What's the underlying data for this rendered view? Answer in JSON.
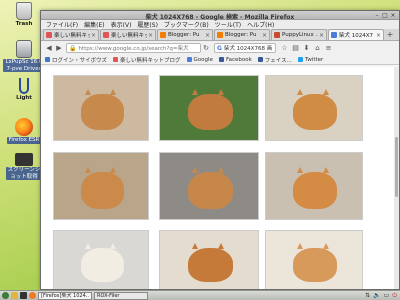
{
  "desktop": {
    "icons": [
      {
        "label": "Trash",
        "icon": "trash-icon"
      },
      {
        "label": "LxPupSc 16.0\n7-pve Drives",
        "icon": "drive-icon"
      },
      {
        "label": "Light",
        "icon": "light-icon"
      },
      {
        "label": "Firefox ESR",
        "icon": "firefox-icon"
      },
      {
        "label": "スクリーンシ\nョット取得",
        "icon": "camera-icon"
      }
    ]
  },
  "window": {
    "title": "柴犬 1024X768 - Google 検索 - Mozilla Firefox",
    "menu": [
      "ファイル(F)",
      "編集(E)",
      "表示(V)",
      "履歴(S)",
      "ブックマーク(B)",
      "ツール(T)",
      "ヘルプ(H)"
    ],
    "tabs": [
      {
        "label": "楽しい無料キット",
        "favicon": "bookmark-icon",
        "color": "#e05555"
      },
      {
        "label": "楽しい無料キットB",
        "favicon": "bookmark-icon",
        "color": "#e05555"
      },
      {
        "label": "Blogger: Pu",
        "favicon": "blogger-icon",
        "color": "#f57d00"
      },
      {
        "label": "Blogger: Pu",
        "favicon": "blogger-icon",
        "color": "#f57d00"
      },
      {
        "label": "PuppyLinux ...",
        "favicon": "puppy-icon",
        "color": "#c84a2f"
      },
      {
        "label": "柴犬 1024X7",
        "favicon": "google-icon",
        "color": "#4a7ed8"
      }
    ],
    "url": "https://www.google.co.jp/search?q=柴犬",
    "search_query": "柴犬 1024X768 画",
    "bookmarks": [
      {
        "label": "ログイン・サイボウズ",
        "color": "#3a78c8"
      },
      {
        "label": "楽しい無料キットブログ",
        "color": "#e05555"
      },
      {
        "label": "Google",
        "color": "#4a7ed8"
      },
      {
        "label": "Facebook",
        "color": "#3b5998"
      },
      {
        "label": "フェイス...",
        "color": "#3b5998"
      },
      {
        "label": "Twitter",
        "color": "#1da1f2"
      }
    ]
  },
  "results": {
    "images": [
      {
        "description": "shiba-lying-on-floor",
        "bg": "#cdb8a0",
        "dog": "#c8894c"
      },
      {
        "description": "shiba-on-grass",
        "bg": "#4f7a3a",
        "dog": "#c27b3f"
      },
      {
        "description": "shiba-puppy-closeup",
        "bg": "#d9d2c3",
        "dog": "#d08b45"
      },
      {
        "description": "shiba-puppy-on-wooden-board",
        "bg": "#b9a58a",
        "dog": "#cc8a4a"
      },
      {
        "description": "shiba-on-sofa",
        "bg": "#8e8b86",
        "dog": "#c8874a"
      },
      {
        "description": "shiba-puppy-portrait",
        "bg": "#c9c0b2",
        "dog": "#d48c44"
      },
      {
        "description": "white-shiba-head",
        "bg": "#dad8d4",
        "dog": "#f2ede3"
      },
      {
        "description": "shiba-standing-tiled-floor",
        "bg": "#e4ddcf",
        "dog": "#c67a3a"
      },
      {
        "description": "two-shiba-dogs",
        "bg": "#ece6da",
        "dog": "#d89a5a"
      }
    ]
  },
  "taskbar": {
    "tasks": [
      {
        "label": "[Firefox]柴犬 1024..."
      },
      {
        "label": "ROX-Filer"
      }
    ],
    "tray_icons": [
      "network-icon",
      "volume-icon",
      "battery-icon",
      "power-icon"
    ]
  }
}
